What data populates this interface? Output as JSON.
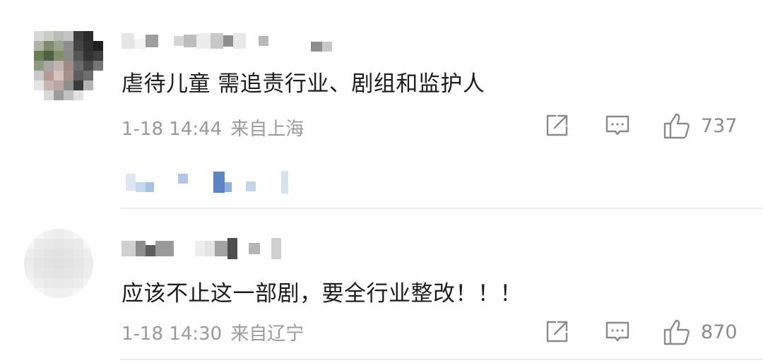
{
  "comments": [
    {
      "text": "虐待儿童 需追责行业、剧组和监护人",
      "time": "1-18 14:44",
      "location": "来自上海",
      "likes": "737",
      "icons": [
        "share-icon",
        "reply-icon",
        "like-icon"
      ]
    },
    {
      "text": "应该不止这一部剧，要全行业整改！！！",
      "time": "1-18 14:30",
      "location": "来自辽宁",
      "likes": "870",
      "icons": [
        "share-icon",
        "reply-icon",
        "like-icon"
      ]
    }
  ],
  "colors": {
    "text": "#1c1c1c",
    "meta": "#9a9a9a",
    "icon": "#8a8a8a",
    "divider": "#ececec",
    "pixelated_link": "#5b86c4"
  }
}
